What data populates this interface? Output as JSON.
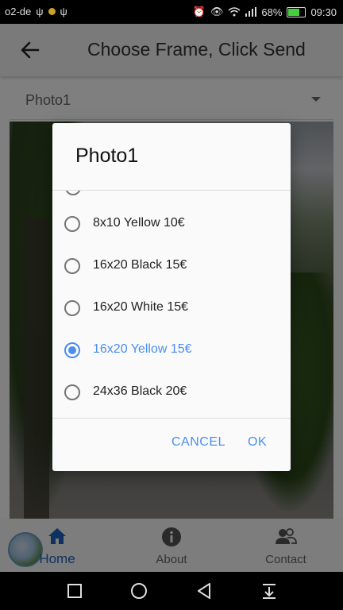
{
  "status_bar": {
    "carrier": "o2-de",
    "battery": "68%",
    "time": "09:30",
    "icons": [
      "usb-icon",
      "notification-dot-icon",
      "usb-icon",
      "alarm-icon",
      "eye-icon",
      "wifi-icon",
      "signal-icon",
      "battery-icon"
    ]
  },
  "appbar": {
    "title": "Choose Frame, Click Send",
    "back_icon": "arrow-left-icon"
  },
  "select": {
    "value": "Photo1"
  },
  "dialog": {
    "title": "Photo1",
    "options": [
      {
        "label": "8x10 Yellow 10€",
        "checked": false
      },
      {
        "label": "16x20 Black 15€",
        "checked": false
      },
      {
        "label": "16x20 White 15€",
        "checked": false
      },
      {
        "label": "16x20 Yellow 15€",
        "checked": true
      },
      {
        "label": "24x36 Black 20€",
        "checked": false
      }
    ],
    "cancel": "CANCEL",
    "ok": "OK",
    "accent": "#4a8ef0"
  },
  "bottom_nav": {
    "items": [
      {
        "label": "Home",
        "icon": "home-icon",
        "active": true
      },
      {
        "label": "About",
        "icon": "info-icon",
        "active": false
      },
      {
        "label": "Contact",
        "icon": "contacts-icon",
        "active": false
      }
    ]
  },
  "system_nav": [
    "square-icon",
    "circle-icon",
    "triangle-back-icon",
    "download-icon"
  ]
}
